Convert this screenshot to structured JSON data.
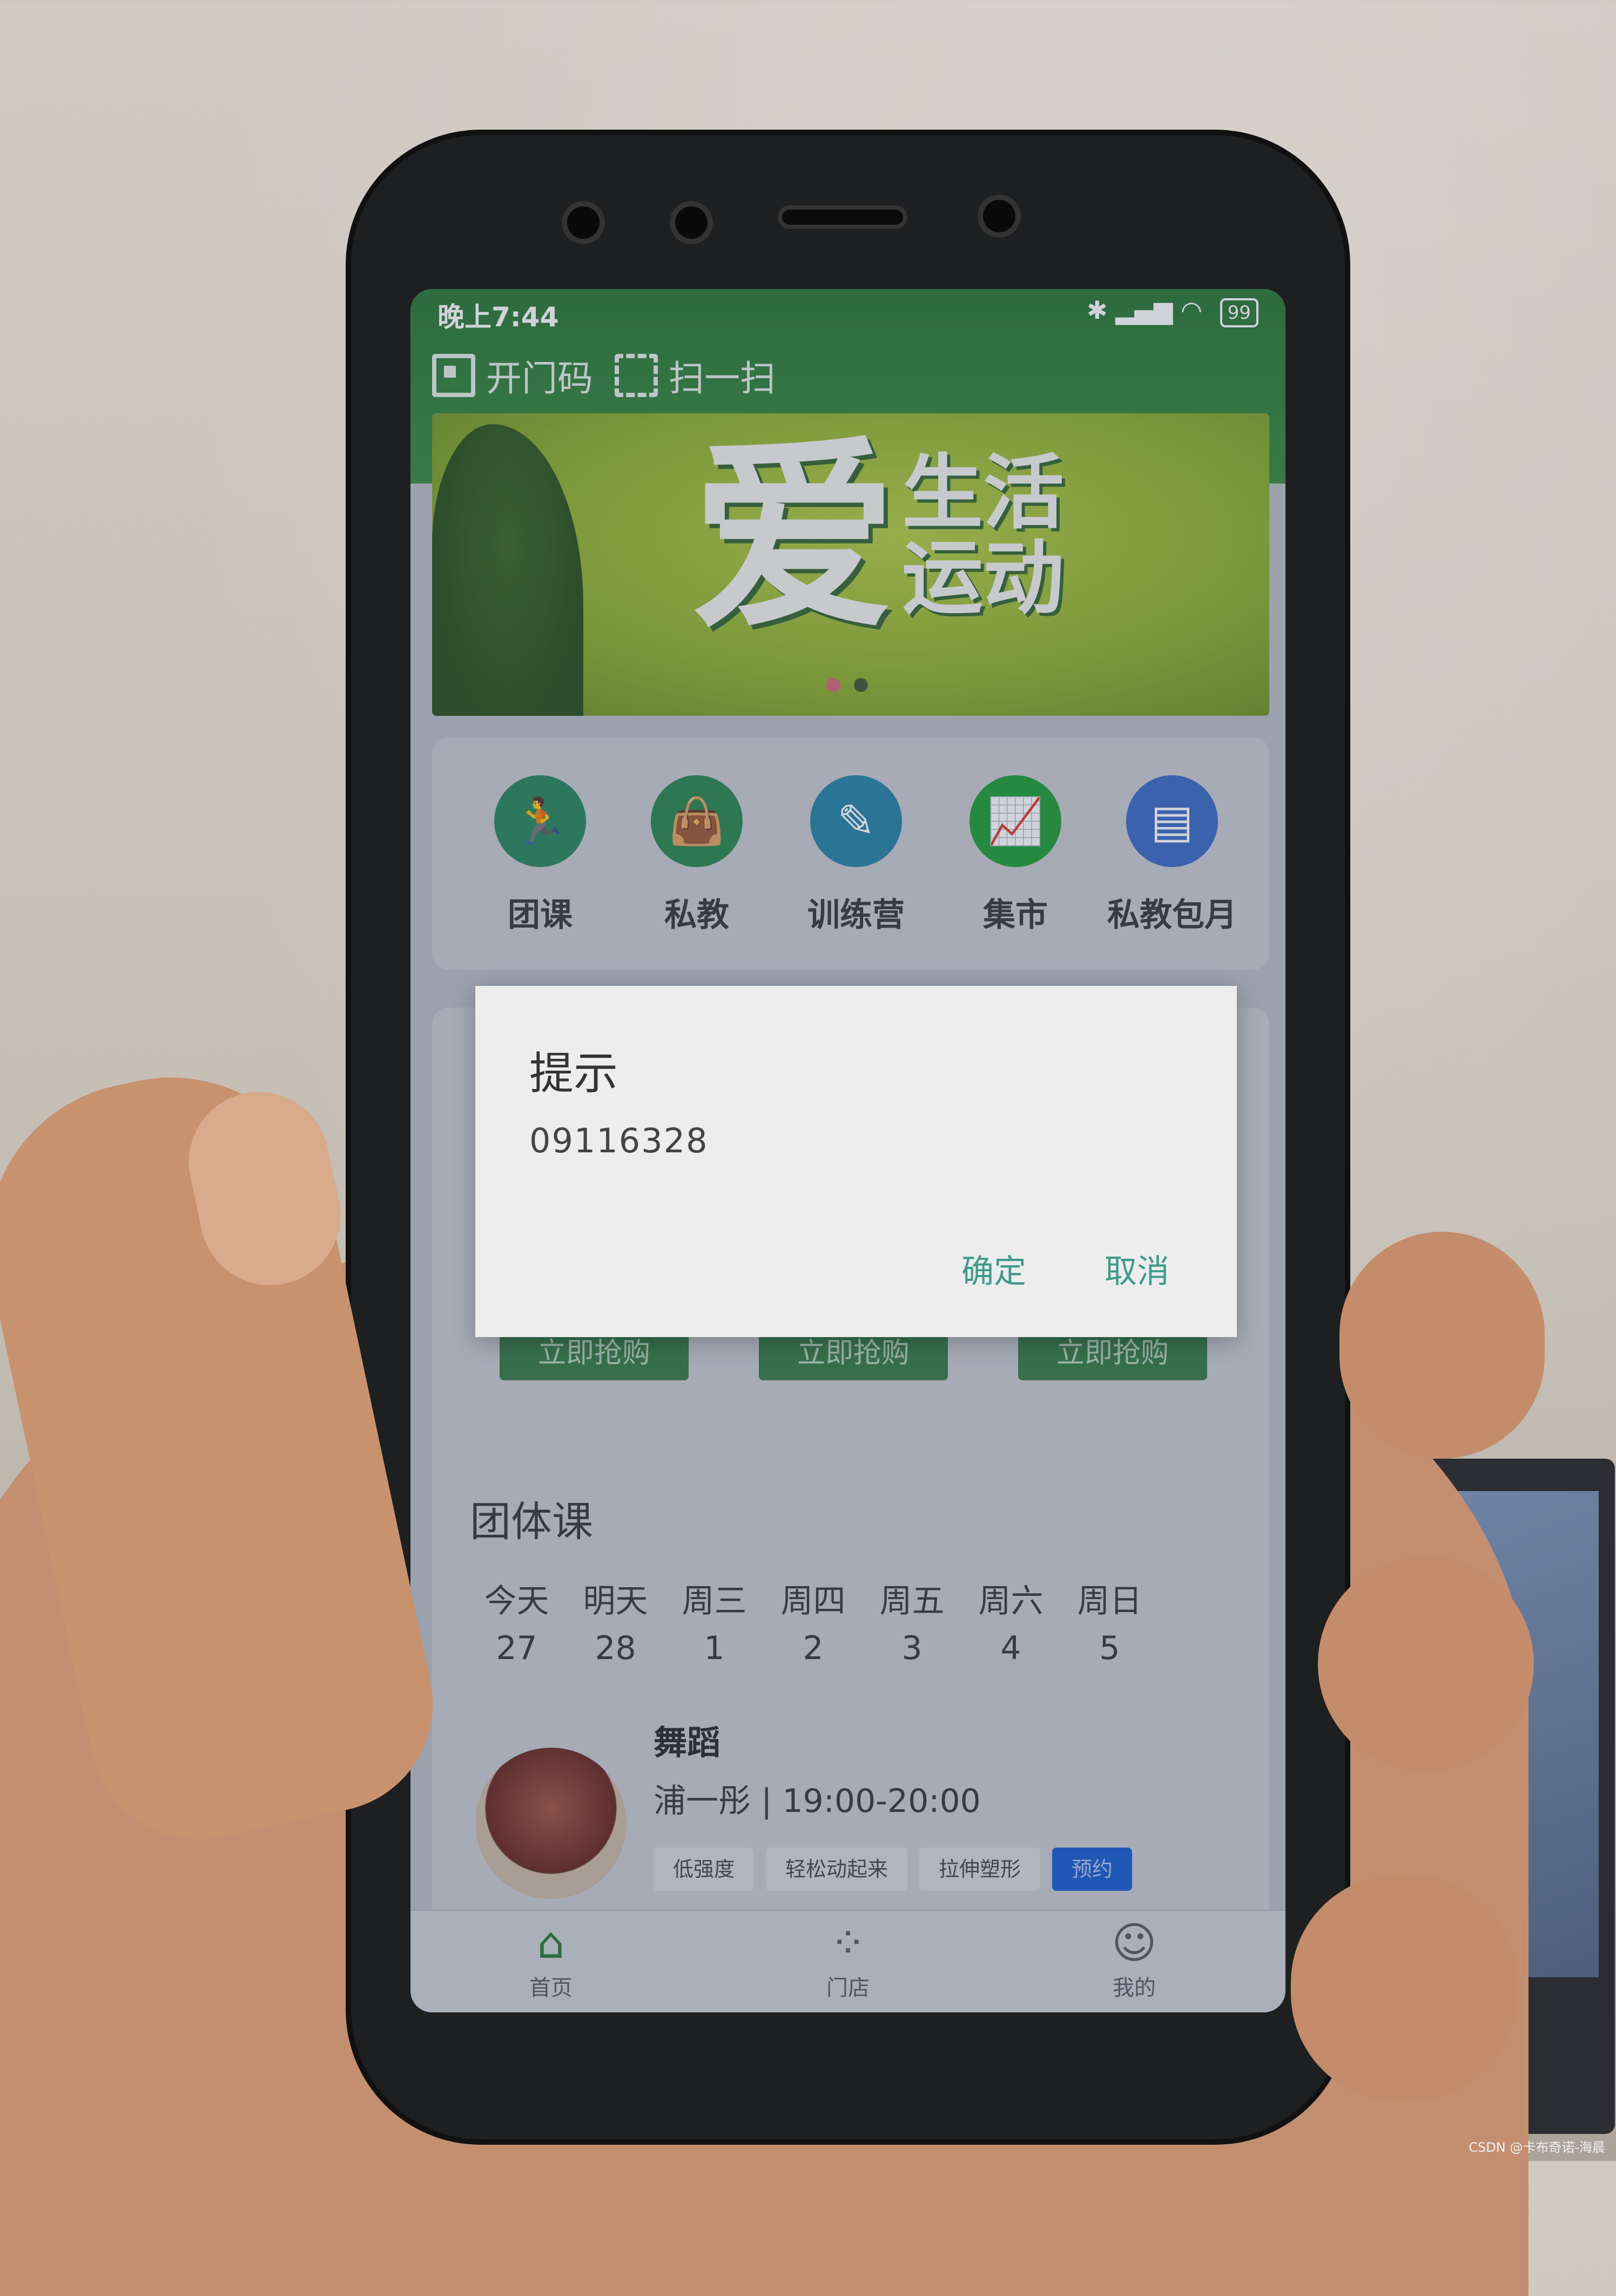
{
  "status_bar": {
    "time": "晚上7:44",
    "battery": "99"
  },
  "header": {
    "door_code": "开门码",
    "scan": "扫一扫"
  },
  "banner": {
    "main_text": "爱",
    "sub_text": "生活\n运动"
  },
  "menu": [
    {
      "label": "团课",
      "icon": "running-icon",
      "color": "#2f8a62"
    },
    {
      "label": "私教",
      "icon": "bag-icon",
      "color": "#2f8a52"
    },
    {
      "label": "训练营",
      "icon": "edit-icon",
      "color": "#2b86a9"
    },
    {
      "label": "集市",
      "icon": "chart-board-icon",
      "color": "#24a03b"
    },
    {
      "label": "私教包月",
      "icon": "document-icon",
      "color": "#3f6fc7"
    }
  ],
  "promo": {
    "buy_label": "立即抢购"
  },
  "group_class": {
    "title": "团体课",
    "days": [
      {
        "name": "今天",
        "num": "27"
      },
      {
        "name": "明天",
        "num": "28"
      },
      {
        "name": "周三",
        "num": "1"
      },
      {
        "name": "周四",
        "num": "2"
      },
      {
        "name": "周五",
        "num": "3"
      },
      {
        "name": "周六",
        "num": "4"
      },
      {
        "name": "周日",
        "num": "5"
      }
    ],
    "course": {
      "name": "舞蹈",
      "info": "浦一彤 | 19:00-20:00",
      "tags": [
        "低强度",
        "轻松动起来",
        "拉伸塑形"
      ],
      "book_label": "预约"
    }
  },
  "dialog": {
    "title": "提示",
    "message": "09116328",
    "confirm": "确定",
    "cancel": "取消"
  },
  "tabbar": [
    {
      "label": "首页",
      "icon": "home-icon",
      "active": true
    },
    {
      "label": "门店",
      "icon": "grid-icon",
      "active": false
    },
    {
      "label": "我的",
      "icon": "user-icon",
      "active": false
    }
  ],
  "watermark": "CSDN @卡布奇诺-海晨"
}
